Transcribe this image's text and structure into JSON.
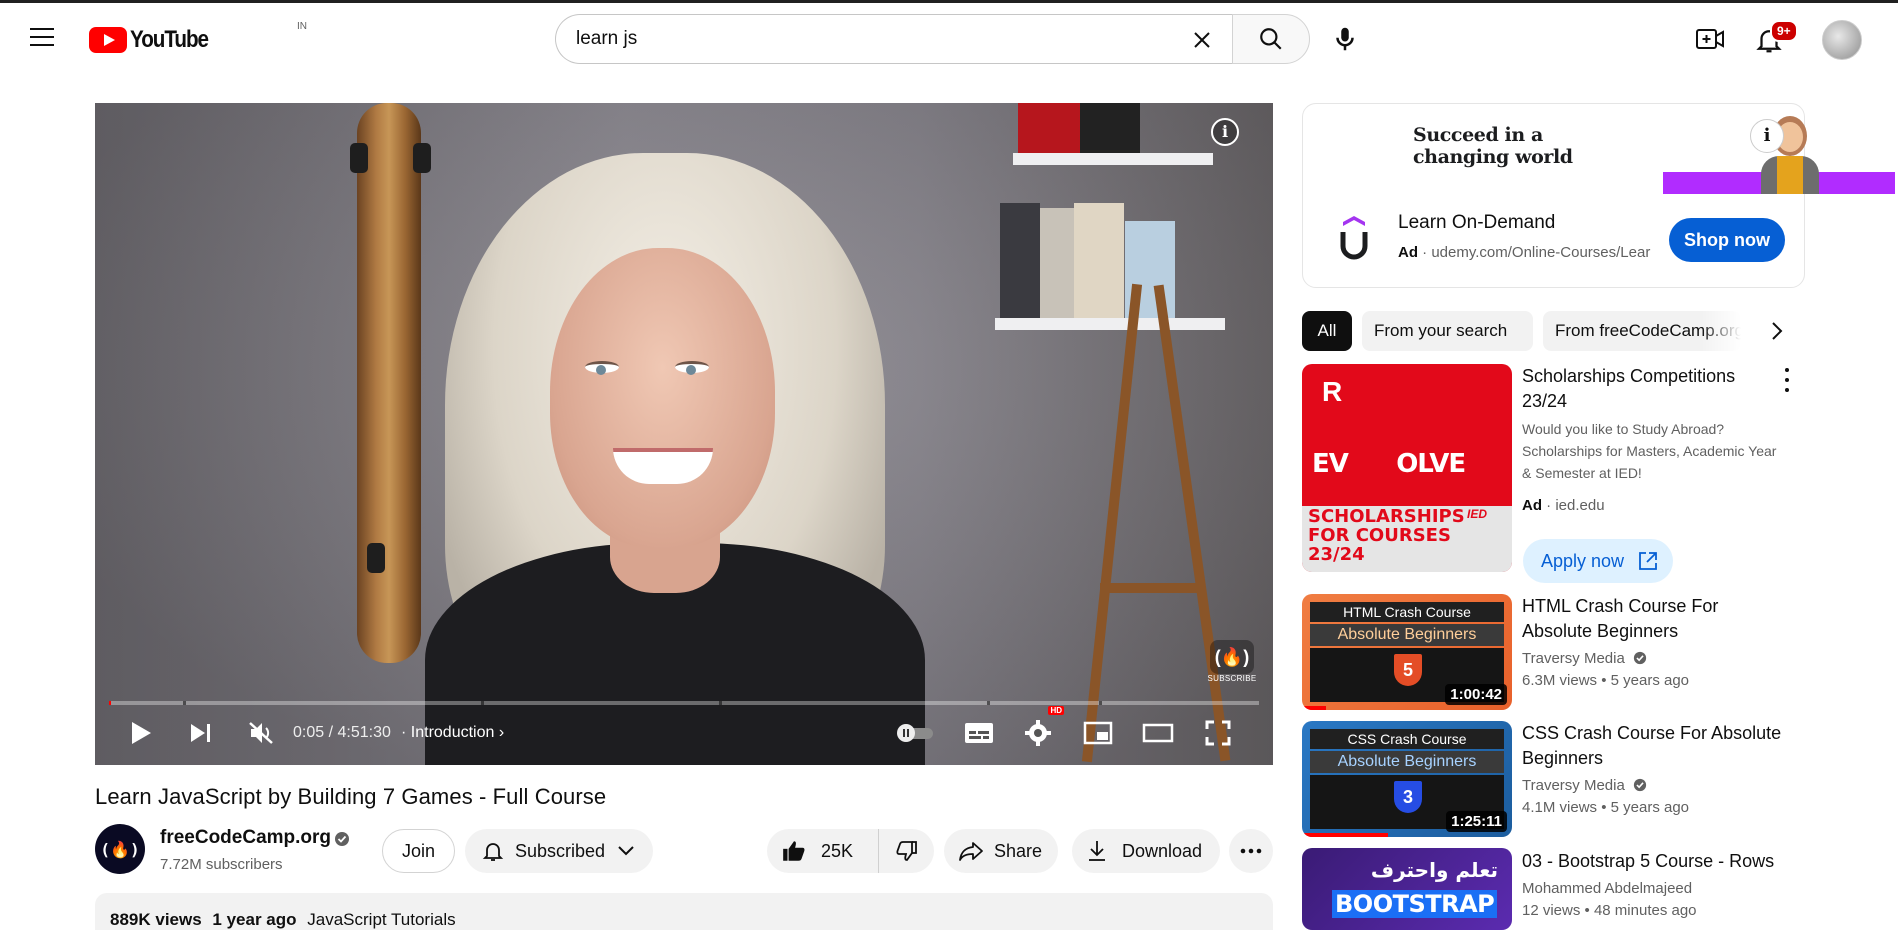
{
  "header": {
    "logo_text": "YouTube",
    "country_code": "IN",
    "search_value": "learn js",
    "notifications_badge": "9+"
  },
  "player": {
    "current_time": "0:05 / 4:51:30",
    "chapter_label": "Introduction",
    "progress_fraction": 0.0003,
    "watermark_label": "SUBSCRIBE",
    "hd_badge": "HD"
  },
  "video": {
    "title": "Learn JavaScript by Building 7 Games - Full Course",
    "channel_name": "freeCodeCamp.org",
    "subscribers": "7.72M subscribers",
    "join_label": "Join",
    "subscribed_label": "Subscribed",
    "likes": "25K",
    "share_label": "Share",
    "download_label": "Download",
    "views": "889K views",
    "age": "1 year ago",
    "tag": "JavaScript Tutorials"
  },
  "ad": {
    "banner_line1": "Succeed in a",
    "banner_line2": "changing world",
    "title": "Learn On-Demand",
    "ad_label": "Ad",
    "url": "udemy.com/Online-Courses/Lear",
    "cta": "Shop now"
  },
  "chips": [
    "All",
    "From your search",
    "From freeCodeCamp.org"
  ],
  "sidebar": {
    "promo": {
      "title": "Scholarships Competitions 23/24",
      "description": "Would you like to Study Abroad? Scholarships for Masters, Academic Year & Semester at IED!",
      "ad_label": "Ad",
      "domain": "ied.edu",
      "cta": "Apply now",
      "thumb_top": "R",
      "thumb_evolve": "EV      OLVE",
      "thumb_caption": "SCHOLARSHIPS FOR COURSES 23/24",
      "thumb_brand": "IED"
    },
    "videos": [
      {
        "title": "HTML Crash Course For Absolute Beginners",
        "channel": "Traversy Media",
        "views": "6.3M views",
        "age": "5 years ago",
        "duration": "1:00:42",
        "thumb_head": "HTML Crash Course",
        "thumb_sub": "Absolute Beginners",
        "thumb_badge": "5"
      },
      {
        "title": "CSS Crash Course For Absolute Beginners",
        "channel": "Traversy Media",
        "views": "4.1M views",
        "age": "5 years ago",
        "duration": "1:25:11",
        "thumb_head": "CSS Crash Course",
        "thumb_sub": "Absolute Beginners",
        "thumb_badge": "3"
      },
      {
        "title": "03 - Bootstrap 5 Course - Rows",
        "channel": "Mohammed Abdelmajeed",
        "views": "12 views",
        "age": "48 minutes ago",
        "thumb_arabic": "تعلم واحترف",
        "thumb_text": "BOOTSTRAP"
      }
    ]
  }
}
